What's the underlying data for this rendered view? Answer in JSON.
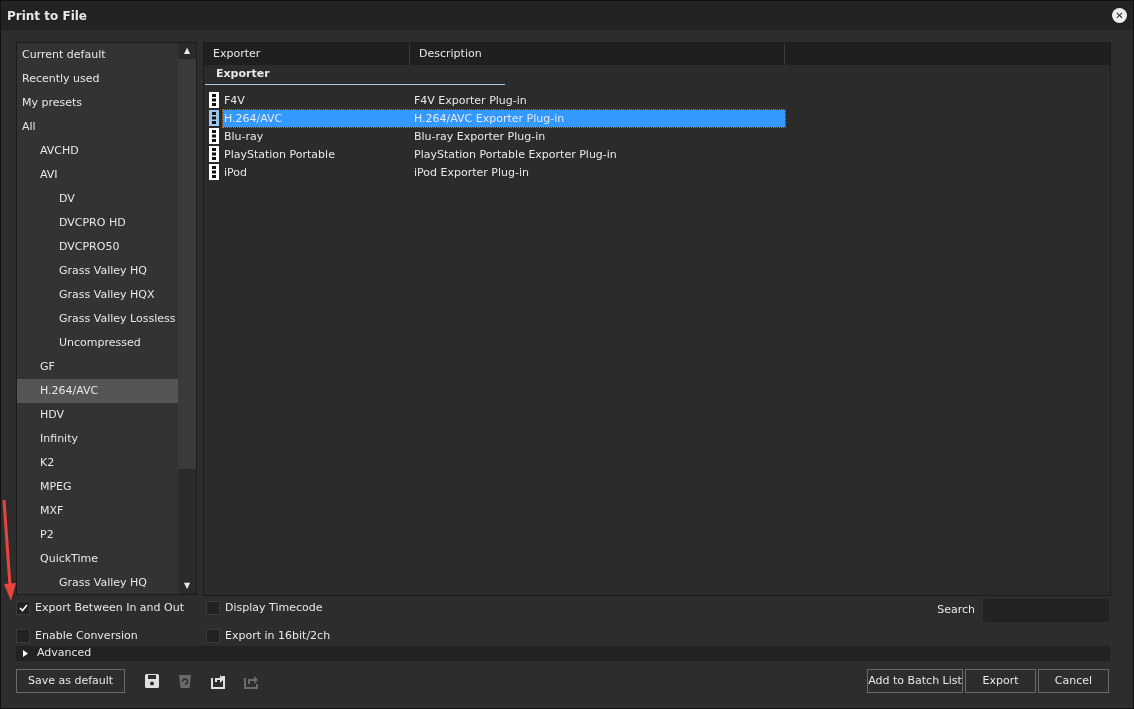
{
  "window": {
    "title": "Print to File",
    "close": "✕"
  },
  "tree": [
    {
      "label": "Current default",
      "selected": false
    },
    {
      "label": "Recently used",
      "selected": false
    },
    {
      "label": "My presets",
      "selected": false
    },
    {
      "label": "All",
      "selected": false,
      "children": [
        {
          "label": "AVCHD",
          "selected": false
        },
        {
          "label": "AVI",
          "selected": false,
          "children": [
            {
              "label": "DV",
              "selected": false
            },
            {
              "label": "DVCPRO HD",
              "selected": false
            },
            {
              "label": "DVCPRO50",
              "selected": false
            },
            {
              "label": "Grass Valley HQ",
              "selected": false
            },
            {
              "label": "Grass Valley HQX",
              "selected": false
            },
            {
              "label": "Grass Valley Lossless",
              "selected": false
            },
            {
              "label": "Uncompressed",
              "selected": false
            }
          ]
        },
        {
          "label": "GF",
          "selected": false
        },
        {
          "label": "H.264/AVC",
          "selected": true
        },
        {
          "label": "HDV",
          "selected": false
        },
        {
          "label": "Infinity",
          "selected": false
        },
        {
          "label": "K2",
          "selected": false
        },
        {
          "label": "MPEG",
          "selected": false
        },
        {
          "label": "MXF",
          "selected": false
        },
        {
          "label": "P2",
          "selected": false
        },
        {
          "label": "QuickTime",
          "selected": false,
          "children": [
            {
              "label": "Grass Valley HQ",
              "selected": false
            }
          ]
        }
      ]
    }
  ],
  "scroll_up": "▲",
  "scroll_down": "▼",
  "table": {
    "columns": [
      "Exporter",
      "Description"
    ],
    "group": "Exporter",
    "rows": [
      {
        "exporter": "F4V",
        "description": "F4V Exporter Plug-in",
        "selected": false
      },
      {
        "exporter": "H.264/AVC",
        "description": "H.264/AVC Exporter Plug-in",
        "selected": true
      },
      {
        "exporter": "Blu-ray",
        "description": "Blu-ray Exporter Plug-in",
        "selected": false
      },
      {
        "exporter": "PlayStation Portable",
        "description": "PlayStation Portable Exporter Plug-in",
        "selected": false
      },
      {
        "exporter": "iPod",
        "description": "iPod Exporter Plug-in",
        "selected": false
      }
    ]
  },
  "options": [
    {
      "label": "Export Between In and Out",
      "checked": true
    },
    {
      "label": "Display Timecode",
      "checked": false
    },
    {
      "label": "Enable Conversion",
      "checked": false
    },
    {
      "label": "Export in 16bit/2ch",
      "checked": false
    }
  ],
  "search": {
    "label": "Search"
  },
  "advanced": {
    "label": "Advanced",
    "expanded": false
  },
  "save_default": "Save as default",
  "toolbar": [
    {
      "kind": "save",
      "disabled": false
    },
    {
      "kind": "delete",
      "disabled": true
    },
    {
      "kind": "import",
      "disabled": false
    },
    {
      "kind": "export",
      "disabled": true
    }
  ],
  "buttons": [
    "Add to Batch List",
    "Export",
    "Cancel"
  ]
}
